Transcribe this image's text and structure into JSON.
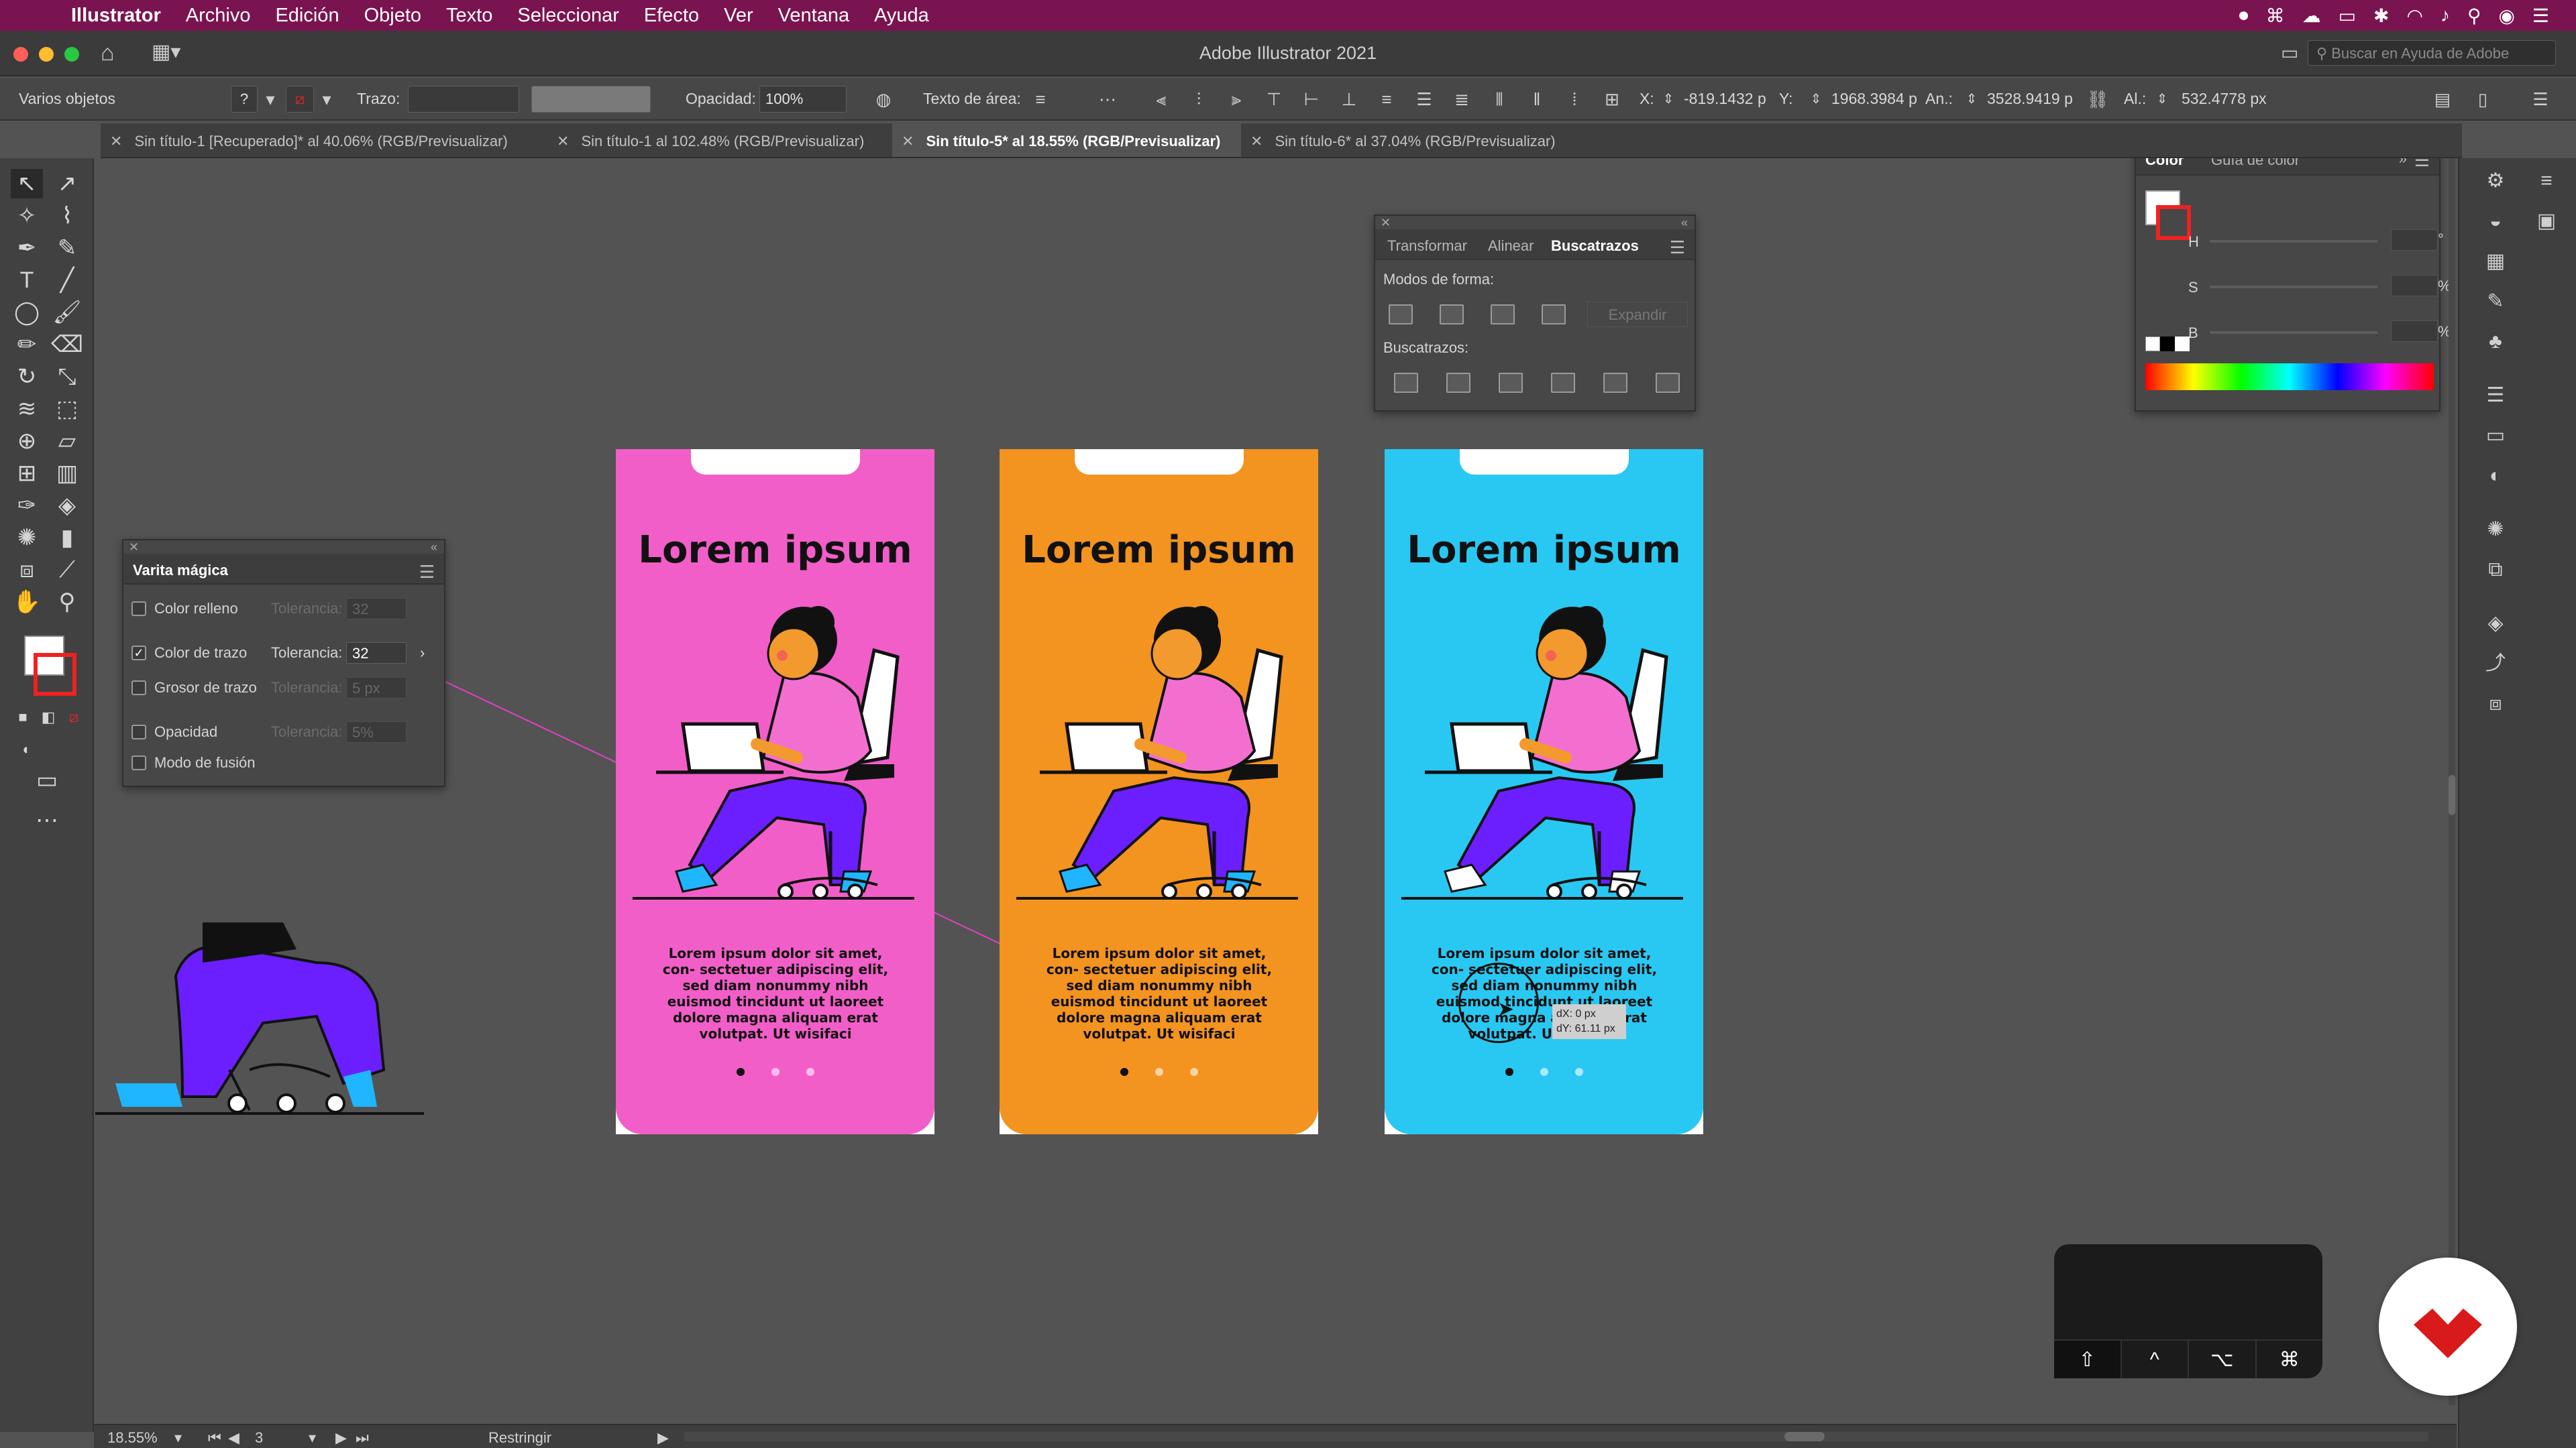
{
  "menubar": {
    "app": "Illustrator",
    "items": [
      "Archivo",
      "Edición",
      "Objeto",
      "Texto",
      "Seleccionar",
      "Efecto",
      "Ver",
      "Ventana",
      "Ayuda"
    ]
  },
  "window": {
    "title": "Adobe Illustrator 2021",
    "search_placeholder": "Buscar en Ayuda de Adobe"
  },
  "control": {
    "selection": "Varios objetos",
    "stroke_label": "Trazo:",
    "opacity_label": "Opacidad:",
    "opacity_value": "100%",
    "area_text_label": "Texto de área:",
    "x_label": "X:",
    "x_value": "-819.1432 p",
    "y_label": "Y:",
    "y_value": "1968.3984 p",
    "w_label": "An.:",
    "w_value": "3528.9419 p",
    "h_label": "Al.:",
    "h_value": "532.4778 px"
  },
  "tabs": [
    {
      "label": "Sin título-1 [Recuperado]* al 40.06% (RGB/Previsualizar)",
      "active": false
    },
    {
      "label": "Sin título-1 al 102.48% (RGB/Previsualizar)",
      "active": false
    },
    {
      "label": "Sin título-5* al 18.55% (RGB/Previsualizar)",
      "active": true
    },
    {
      "label": "Sin título-6* al 37.04% (RGB/Previsualizar)",
      "active": false
    }
  ],
  "artboards": [
    {
      "headline": "Lorem ipsum",
      "body": "Lorem ipsum dolor sit amet, con- sectetuer adipiscing elit, sed diam nonummy nibh euismod tincidunt ut laoreet dolore magna aliquam erat volutpat. Ut wisifaci",
      "bg": "#f25ec8"
    },
    {
      "headline": "Lorem ipsum",
      "body": "Lorem ipsum dolor sit amet, con- sectetuer adipiscing elit, sed diam nonummy nibh euismod tincidunt ut laoreet dolore magna aliquam erat volutpat. Ut wisifaci",
      "bg": "#f39320"
    },
    {
      "headline": "Lorem ipsum",
      "body": "Lorem ipsum dolor sit amet, con- sectetuer adipiscing elit, sed diam nonummy nibh euismod tincidunt ut laoreet dolore magna aliquam erat volutpat. Ut wisifaci",
      "bg": "#29c8f2"
    }
  ],
  "cursor_tooltip": {
    "dx": "dX: 0 px",
    "dy": "dY: 61.11 px"
  },
  "magic_wand": {
    "title": "Varita mágica",
    "tolerance_label": "Tolerancia:",
    "rows": [
      {
        "label": "Color relleno",
        "checked": false,
        "tolerance": "32",
        "enabled": false
      },
      {
        "label": "Color de trazo",
        "checked": true,
        "tolerance": "32",
        "enabled": true
      },
      {
        "label": "Grosor de trazo",
        "checked": false,
        "tolerance": "5 px",
        "enabled": false
      },
      {
        "label": "Opacidad",
        "checked": false,
        "tolerance": "5%",
        "enabled": false
      },
      {
        "label": "Modo de fusión",
        "checked": false
      }
    ]
  },
  "pathfinder": {
    "tabs": [
      "Transformar",
      "Alinear",
      "Buscatrazos"
    ],
    "shape_modes_label": "Modos de forma:",
    "expand_label": "Expandir",
    "pathfinders_label": "Buscatrazos:"
  },
  "color_panel": {
    "tabs": [
      "Color",
      "Guía de color"
    ],
    "h_label": "H",
    "s_label": "S",
    "b_label": "B",
    "deg": "°",
    "pct": "%"
  },
  "keyboard": {
    "keys": [
      "⇧",
      "^",
      "⌥",
      "⌘"
    ]
  },
  "status": {
    "zoom": "18.55%",
    "artboard_num": "3",
    "mode": "Restringir"
  },
  "colors": {
    "menubar": "#7a1450",
    "magenta_guide": "#e040c8",
    "purple": "#6b1fff",
    "pink_shirt": "#f36fcf",
    "skin": "#f29a2e"
  }
}
